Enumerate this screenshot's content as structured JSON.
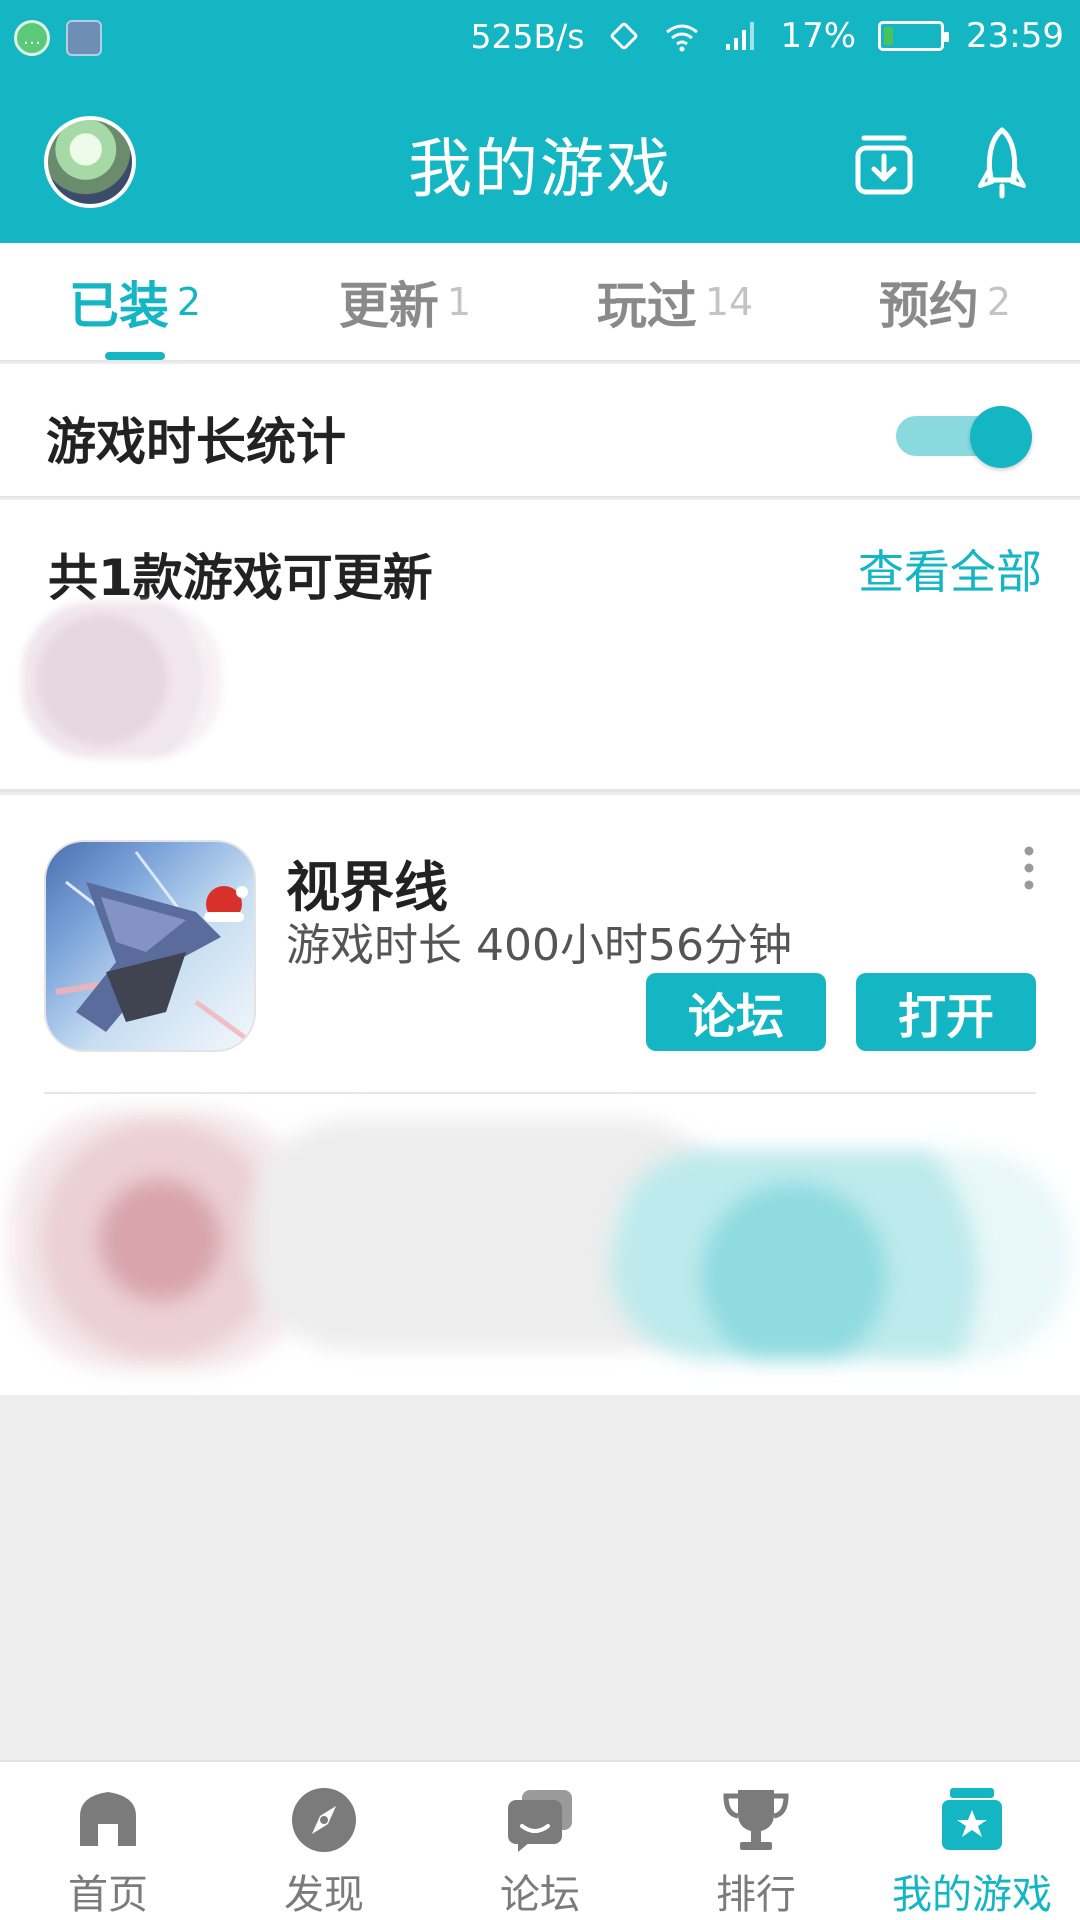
{
  "status_bar": {
    "net_speed": "525B/s",
    "battery_percent": "17%",
    "battery_level": 0.17,
    "time": "23:59"
  },
  "header": {
    "title": "我的游戏"
  },
  "tabs": [
    {
      "label": "已装",
      "count": "2",
      "active": true
    },
    {
      "label": "更新",
      "count": "1",
      "active": false
    },
    {
      "label": "玩过",
      "count": "14",
      "active": false
    },
    {
      "label": "预约",
      "count": "2",
      "active": false
    }
  ],
  "stats": {
    "label": "游戏时长统计",
    "enabled": true
  },
  "updates": {
    "title": "共1款游戏可更新",
    "view_all": "查看全部"
  },
  "game": {
    "name": "视界线",
    "playtime": "游戏时长 400小时56分钟",
    "forum_button": "论坛",
    "open_button": "打开"
  },
  "bottom_nav": [
    {
      "label": "首页",
      "icon": "home-icon",
      "active": false
    },
    {
      "label": "发现",
      "icon": "compass-icon",
      "active": false
    },
    {
      "label": "论坛",
      "icon": "chat-icon",
      "active": false
    },
    {
      "label": "排行",
      "icon": "trophy-icon",
      "active": false
    },
    {
      "label": "我的游戏",
      "icon": "my-games-icon",
      "active": true
    }
  ],
  "colors": {
    "accent": "#14b6c4",
    "inactive_text": "#8a8a8a",
    "background": "#ededed"
  }
}
